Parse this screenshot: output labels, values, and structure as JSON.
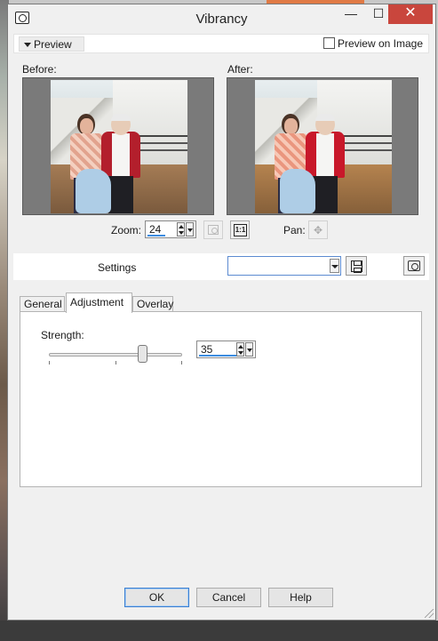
{
  "window": {
    "title": "Vibrancy",
    "controls": {
      "minimize": "—",
      "maximize": "☐",
      "close": "✕"
    }
  },
  "preview": {
    "toggle_label": "Preview",
    "preview_on_image_label": "Preview on Image",
    "preview_on_image_checked": false,
    "before_label": "Before:",
    "after_label": "After:"
  },
  "zoom": {
    "label": "Zoom:",
    "value": "24",
    "one_to_one_label": "1:1",
    "pan_label": "Pan:",
    "pan_glyph": "✥"
  },
  "settings": {
    "label": "Settings",
    "selected_value": ""
  },
  "tabs": [
    {
      "label": "General",
      "active": false
    },
    {
      "label": "Adjustment",
      "active": true
    },
    {
      "label": "Overlay",
      "active": false
    }
  ],
  "adjustment": {
    "strength_label": "Strength:",
    "strength_value": "35",
    "strength_fraction": 0.7
  },
  "buttons": {
    "ok": "OK",
    "cancel": "Cancel",
    "help": "Help"
  },
  "colors": {
    "close_button": "#c9463d",
    "default_button_border": "#3c7fd1",
    "spin_underline": "#3c8ce0"
  }
}
